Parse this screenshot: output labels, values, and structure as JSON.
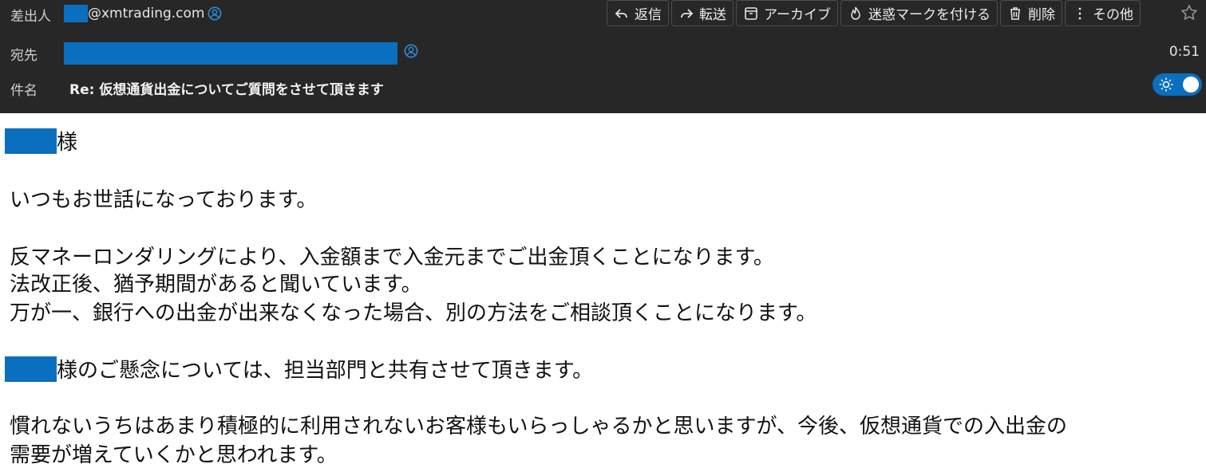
{
  "header": {
    "from_label": "差出人",
    "from_email": "@xmtrading.com",
    "to_label": "宛先",
    "subject_label": "件名",
    "subject": "Re: 仮想通貨出金についてご質問をさせて頂きます",
    "time": "0:51"
  },
  "toolbar": {
    "reply": "返信",
    "forward": "転送",
    "archive": "アーカイブ",
    "junk": "迷惑マークを付ける",
    "delete": "削除",
    "more": "その他"
  },
  "colors": {
    "header_bg": "#272727",
    "redaction": "#0a6fbf",
    "accent": "#0a6fbf"
  },
  "body": {
    "salutation_suffix": "様",
    "greeting": "いつもお世話になっております。",
    "p1": "反マネーロンダリングにより、入金額まで入金元までご出金頂くことになります。",
    "p2": "法改正後、猶予期間があると聞いています。",
    "p3": "万が一、銀行への出金が出来なくなった場合、別の方法をご相談頂くことになります。",
    "p4_suffix": "様のご懸念については、担当部門と共有させて頂きます。",
    "p5": "慣れないうちはあまり積極的に利用されないお客様もいらっしゃるかと思いますが、今後、仮想通貨での入出金の",
    "p6": "需要が増えていくかと思われます。"
  }
}
